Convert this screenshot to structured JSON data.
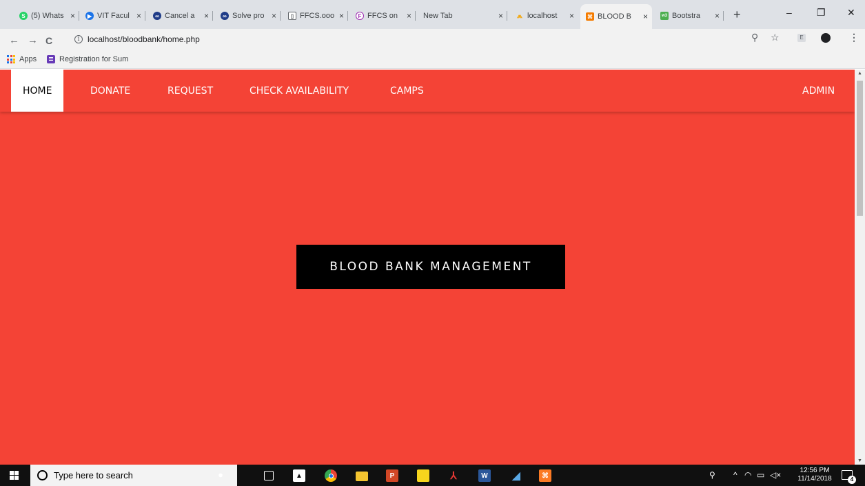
{
  "browser": {
    "tabs": [
      {
        "title": "(5) Whats",
        "color": "#25d366",
        "glyph": "S"
      },
      {
        "title": "VIT Facul",
        "color": "#1a73e8",
        "glyph": "▶"
      },
      {
        "title": "Cancel a",
        "color": "#1f3c88",
        "glyph": "∞"
      },
      {
        "title": "Solve pro",
        "color": "#1f3c88",
        "glyph": "∞"
      },
      {
        "title": "FFCS.ooo",
        "color": "#ffffff",
        "glyph": "▯"
      },
      {
        "title": "FFCS on",
        "color": "#9c27b0",
        "glyph": "F"
      },
      {
        "title": "New Tab",
        "color": "",
        "glyph": ""
      },
      {
        "title": "localhost",
        "color": "#f4a300",
        "glyph": "⩕"
      },
      {
        "title": "BLOOD B",
        "color": "#f57c00",
        "glyph": "⌘"
      },
      {
        "title": "Bootstra",
        "color": "#4caf50",
        "glyph": "w3"
      }
    ],
    "active_tab_index": 8,
    "tab_close": "×",
    "new_tab": "+",
    "window_controls": {
      "minimize": "–",
      "restore": "❐",
      "close": "✕"
    },
    "nav": {
      "back": "←",
      "forward": "→",
      "reload": "C"
    },
    "url": "localhost/bloodbank/home.php",
    "bookmarks": [
      {
        "label": "Apps",
        "icon": "apps-grid-icon"
      },
      {
        "label": "Registration for Sum",
        "icon": "google-forms-icon"
      }
    ]
  },
  "page": {
    "nav_items": [
      {
        "label": "HOME",
        "active": true
      },
      {
        "label": "DONATE",
        "active": false
      },
      {
        "label": "REQUEST",
        "active": false
      },
      {
        "label": "CHECK AVAILABILITY",
        "active": false
      },
      {
        "label": "CAMPS",
        "active": false
      }
    ],
    "nav_right": "ADMIN",
    "hero_title": "BLOOD BANK MANAGEMENT",
    "colors": {
      "primary": "#f44336",
      "hero_bg": "#000000",
      "text": "#ffffff"
    }
  },
  "taskbar": {
    "search_placeholder": "Type here to search",
    "apps": [
      {
        "name": "mic-icon",
        "color": "transparent",
        "glyph": "🎙"
      },
      {
        "name": "task-view-icon",
        "color": "transparent",
        "glyph": "⧉"
      },
      {
        "name": "photos-icon",
        "color": "transparent",
        "glyph": "▲"
      },
      {
        "name": "chrome-icon",
        "color": "#fbbc04",
        "glyph": "●"
      },
      {
        "name": "file-explorer-icon",
        "color": "#f4c430",
        "glyph": "▬"
      },
      {
        "name": "powerpoint-icon",
        "color": "#d24726",
        "glyph": "P"
      },
      {
        "name": "sticky-notes-icon",
        "color": "#f7d51d",
        "glyph": ""
      },
      {
        "name": "acrobat-icon",
        "color": "transparent",
        "glyph": "⅄"
      },
      {
        "name": "word-icon",
        "color": "#2b579a",
        "glyph": "W"
      },
      {
        "name": "app-icon",
        "color": "transparent",
        "glyph": "◢"
      },
      {
        "name": "xampp-icon",
        "color": "#fb7a24",
        "glyph": "⌘"
      }
    ],
    "time": "12:56 PM",
    "date": "11/14/2018",
    "notifications": "4"
  }
}
